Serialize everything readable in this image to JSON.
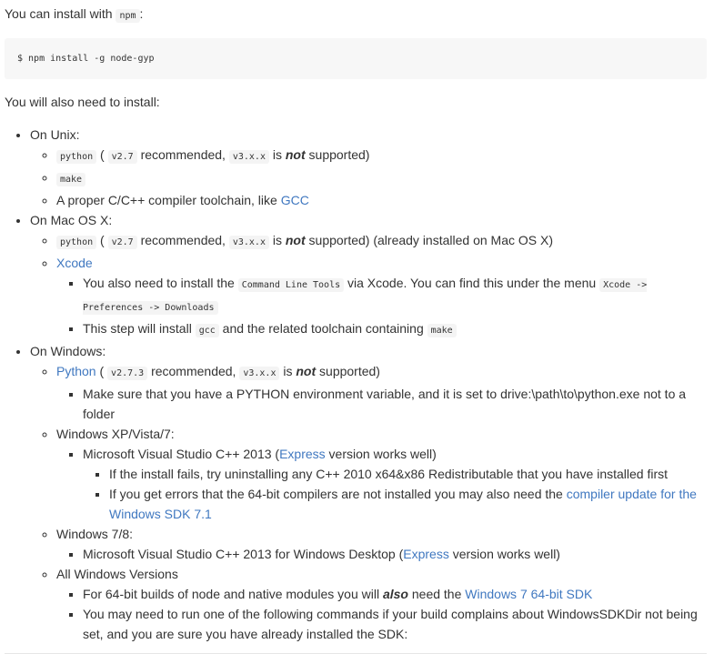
{
  "intro": {
    "text": "You can install with",
    "code": "npm",
    "after": ":"
  },
  "codeblock": "$ npm install -g node-gyp",
  "also": "You will also need to install:",
  "unix": {
    "label": "On Unix:",
    "python": {
      "code": "python",
      "pre": "(",
      "ver": "v2.7",
      "mid": "recommended,",
      "ver3": "v3.x.x",
      "is": "is",
      "not": "not",
      "post": "supported)"
    },
    "make": "make",
    "compiler": {
      "text": "A proper C/C++ compiler toolchain, like",
      "link": "GCC"
    }
  },
  "mac": {
    "label": "On Mac OS X:",
    "python": {
      "code": "python",
      "pre": "(",
      "ver": "v2.7",
      "mid": "recommended,",
      "ver3": "v3.x.x",
      "is": "is",
      "not": "not",
      "post": "supported) (already installed on Mac OS X)"
    },
    "xcode": "Xcode",
    "sub1": {
      "pre": "You also need to install the",
      "code1": "Command Line Tools",
      "mid": "via Xcode. You can find this under the menu",
      "code2": "Xcode -> Preferences -> Downloads"
    },
    "sub2": {
      "pre": "This step will install",
      "code1": "gcc",
      "mid": "and the related toolchain containing",
      "code2": "make"
    }
  },
  "win": {
    "label": "On Windows:",
    "python": {
      "link": "Python",
      "pre": "(",
      "ver": "v2.7.3",
      "mid": "recommended,",
      "ver3": "v3.x.x",
      "is": "is",
      "not": "not",
      "post": "supported)"
    },
    "python_note": "Make sure that you have a PYTHON environment variable, and it is set to drive:\\path\\to\\python.exe not to a folder",
    "xp": {
      "label": "Windows XP/Vista/7:",
      "msvc": {
        "pre": "Microsoft Visual Studio C++ 2013 (",
        "link": "Express",
        "post": "version works well)"
      },
      "note1": "If the install fails, try uninstalling any C++ 2010 x64&x86 Redistributable that you have installed first",
      "note2": {
        "pre": "If you get errors that the 64-bit compilers are not installed you may also need the",
        "link": "compiler update for the Windows SDK 7.1"
      }
    },
    "w78": {
      "label": "Windows 7/8:",
      "msvc": {
        "pre": "Microsoft Visual Studio C++ 2013 for Windows Desktop (",
        "link": "Express",
        "post": "version works well)"
      }
    },
    "all": {
      "label": "All Windows Versions",
      "note1": {
        "pre": "For 64-bit builds of node and native modules you will",
        "em": "also",
        "mid": "need the",
        "link": "Windows 7 64-bit SDK"
      },
      "note2": "You may need to run one of the following commands if your build complains about WindowsSDKDir not being set, and you are sure you have already installed the SDK:"
    }
  }
}
